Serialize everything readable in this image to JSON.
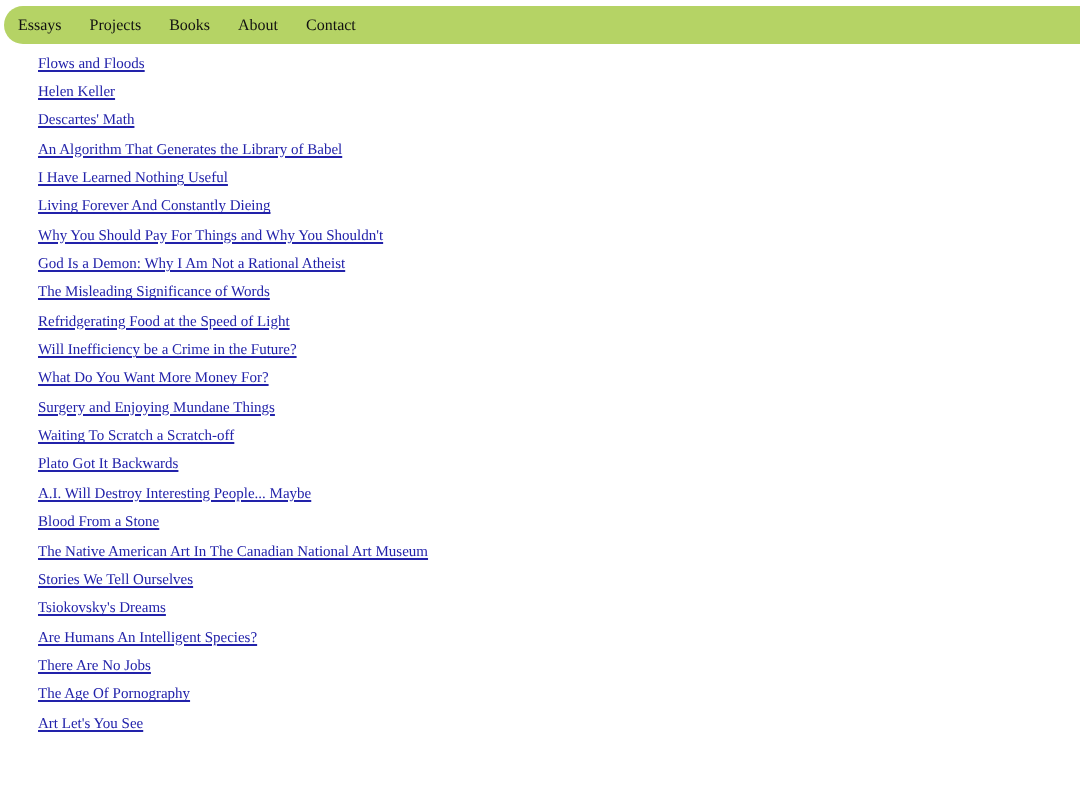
{
  "nav": {
    "items": [
      {
        "label": "Essays"
      },
      {
        "label": "Projects"
      },
      {
        "label": "Books"
      },
      {
        "label": "About"
      },
      {
        "label": "Contact"
      }
    ]
  },
  "essays": [
    "Flows and Floods",
    "Helen Keller",
    "Descartes' Math",
    "An Algorithm That Generates the Library of Babel",
    "I Have Learned Nothing Useful",
    "Living Forever And Constantly Dieing",
    "Why You Should Pay For Things and Why You Shouldn't",
    "God Is a Demon: Why I Am Not a Rational Atheist",
    "The Misleading Significance of Words",
    "Refridgerating Food at the Speed of Light",
    "Will Inefficiency be a Crime in the Future?",
    "What Do You Want More Money For?",
    "Surgery and Enjoying Mundane Things",
    "Waiting To Scratch a Scratch-off",
    "Plato Got It Backwards",
    "A.I. Will Destroy Interesting People... Maybe",
    "Blood From a Stone",
    "The Native American Art In The Canadian National Art Museum",
    "Stories We Tell Ourselves",
    "Tsiokovsky's Dreams",
    "Are Humans An Intelligent Species?",
    "There Are No Jobs",
    "The Age Of Pornography",
    "Art Let's You See"
  ]
}
